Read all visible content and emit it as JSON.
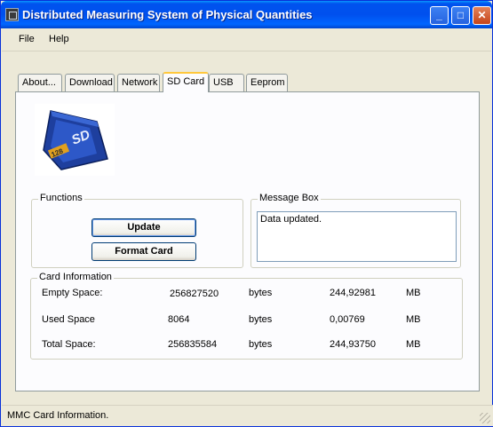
{
  "window": {
    "title": "Distributed Measuring System of Physical Quantities"
  },
  "menu": {
    "file": "File",
    "help": "Help"
  },
  "tabs": [
    {
      "label": "About..."
    },
    {
      "label": "Download"
    },
    {
      "label": "Network"
    },
    {
      "label": "SD Card",
      "active": true
    },
    {
      "label": "USB"
    },
    {
      "label": "Eeprom"
    }
  ],
  "sd_card_image": {
    "card_text": "128",
    "logo": "SD"
  },
  "functions": {
    "title": "Functions",
    "update_label": "Update",
    "format_label": "Format Card"
  },
  "message_box": {
    "title": "Message Box",
    "text": "Data updated."
  },
  "card_info": {
    "title": "Card Information",
    "rows": [
      {
        "label": "Empty Space:",
        "bytes": "256827520",
        "bytes_unit": "bytes",
        "mb": "244,92981",
        "mb_unit": "MB"
      },
      {
        "label": "Used Space",
        "bytes": "8064",
        "bytes_unit": "bytes",
        "mb": "0,00769",
        "mb_unit": "MB"
      },
      {
        "label": "Total Space:",
        "bytes": "256835584",
        "bytes_unit": "bytes",
        "mb": "244,93750",
        "mb_unit": "MB"
      }
    ]
  },
  "status_bar": {
    "text": "MMC Card Information."
  },
  "colors": {
    "titlebar": "#0054e3",
    "active_tab_accent": "#ffc83c",
    "window_bg": "#ece9d8",
    "sd_card": "#2a4fb0"
  }
}
